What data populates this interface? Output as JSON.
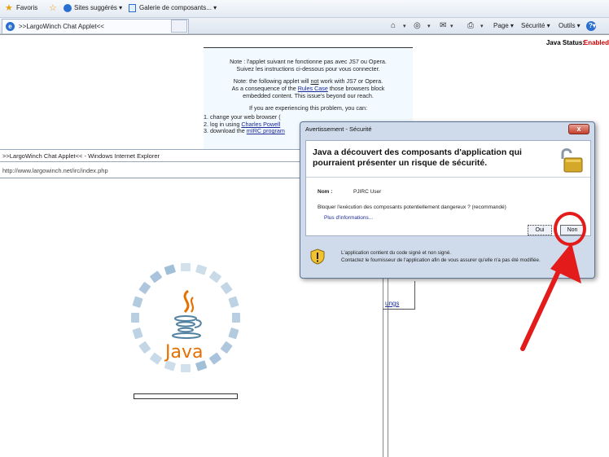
{
  "favorites_bar": {
    "favoris": "Favoris",
    "sites_suggeres": "Sites suggérés ▾",
    "galerie": "Galerie de composants... ▾"
  },
  "tab": {
    "label": ">>LargoWinch Chat Applet<<"
  },
  "command_bar": {
    "page": "Page ▾",
    "securite": "Sécurité ▾",
    "outils": "Outils ▾",
    "help": "?▾"
  },
  "java_status": {
    "label": "Java Status:",
    "value": "Enabled"
  },
  "notice": {
    "line1": "Note : l'applet suivant ne fonctionne pas avec JS7 ou Opera.",
    "line2": "Suivez les instructions ci-dessous pour vous connecter.",
    "line3a": "Note: the following applet will ",
    "line3b": "not",
    "line3c": " work with JS7 or Opera.",
    "line4a": "As a consequence of the ",
    "line4b": "Rules Case",
    "line4c": " those browsers block",
    "line5": "embedded content. This issue's beyond our reach.",
    "line6": "If you are experiencing this problem, you can:",
    "item1": "1. change your web browser (",
    "item2a": "2. log in using ",
    "item2b": "Charles Powell",
    "item3a": "3. download the ",
    "item3b": "mIRC program"
  },
  "second_window": {
    "title": ">>LargoWinch Chat Applet<< - Windows Internet Explorer",
    "address": "http://www.largowinch.net/irc/index.php",
    "link": "ungs"
  },
  "java_loader": {
    "logo_text": "Java",
    "progress": 0
  },
  "dialog": {
    "title": "Avertissement - Sécurité",
    "close": "x",
    "heading": "Java a découvert des composants d'application qui pourraient présenter un risque de sécurité.",
    "name_label": "Nom :",
    "name_value": "PJIRC User",
    "question": "Bloquer l'exécution des composants potentiellement dangereux ? (recommandé)",
    "more_info": "Plus d'informations...",
    "btn_oui": "Oui",
    "btn_non": "Non",
    "warning_line1": "L'application contient du code signé et non signé.",
    "warning_line2": "Contactez le fournisseur de l'application afin de vous assurer qu'elle n'a pas été modifiée."
  },
  "colors": {
    "java_orange": "#e76f00",
    "spinner_blue": "#9dbcd6",
    "annotation_red": "#e31b1b",
    "status_red": "#d00000"
  }
}
